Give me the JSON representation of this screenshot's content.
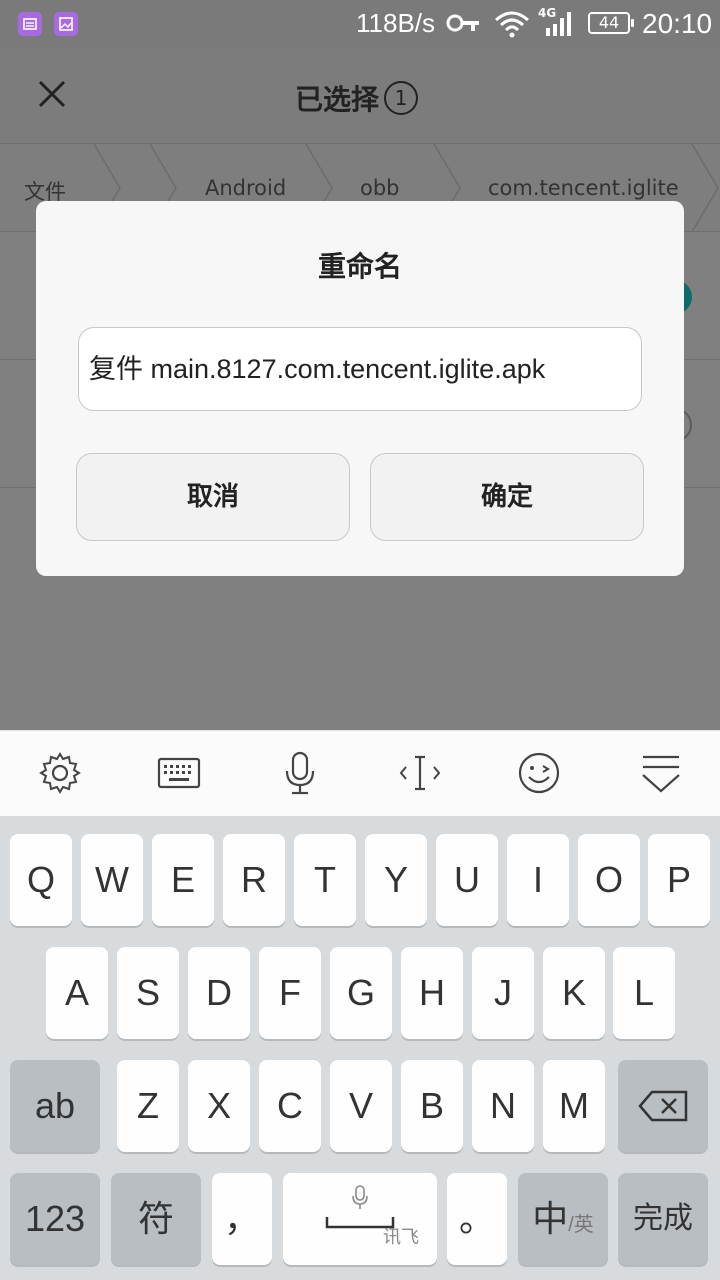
{
  "status_bar": {
    "speed": "118B/s",
    "network_type": "4G",
    "battery": "44",
    "time": "20:10",
    "icons": [
      "notification-icon",
      "image-icon",
      "vpn-key-icon",
      "wifi-icon",
      "signal-icon",
      "battery-icon"
    ]
  },
  "appbar": {
    "title": "已选择",
    "selected_count": "1"
  },
  "breadcrumb": {
    "items": [
      "文件",
      "Android",
      "obb",
      "com.tencent.iglite"
    ]
  },
  "dialog": {
    "title": "重命名",
    "input_value": "复件 main.8127.com.tencent.iglite.apk",
    "cancel_label": "取消",
    "ok_label": "确定"
  },
  "keyboard_toolbar": {
    "icons": [
      "settings-icon",
      "keyboard-icon",
      "microphone-icon",
      "cursor-icon",
      "emoji-icon",
      "hide-keyboard-icon"
    ]
  },
  "keyboard": {
    "row1": [
      "Q",
      "W",
      "E",
      "R",
      "T",
      "Y",
      "U",
      "I",
      "O",
      "P"
    ],
    "row2": [
      "A",
      "S",
      "D",
      "F",
      "G",
      "H",
      "J",
      "K",
      "L"
    ],
    "row3": [
      "Z",
      "X",
      "C",
      "V",
      "B",
      "N",
      "M"
    ],
    "case_label": "ab",
    "num_label": "123",
    "symbol_label": "符",
    "comma_label": "，",
    "space_brand": "讯飞",
    "period_label": "。",
    "lang_main": "中",
    "lang_sub": "/英",
    "done_label": "完成"
  },
  "colors": {
    "overlay": "#808080",
    "dialog_bg": "#f7f7f7",
    "keyboard_bg": "#d7dbde",
    "key_bg": "#fefefe",
    "func_key_bg": "#b9bec2",
    "teal_check": "#0b6d6a",
    "notif_purple": "#a86ae0"
  }
}
